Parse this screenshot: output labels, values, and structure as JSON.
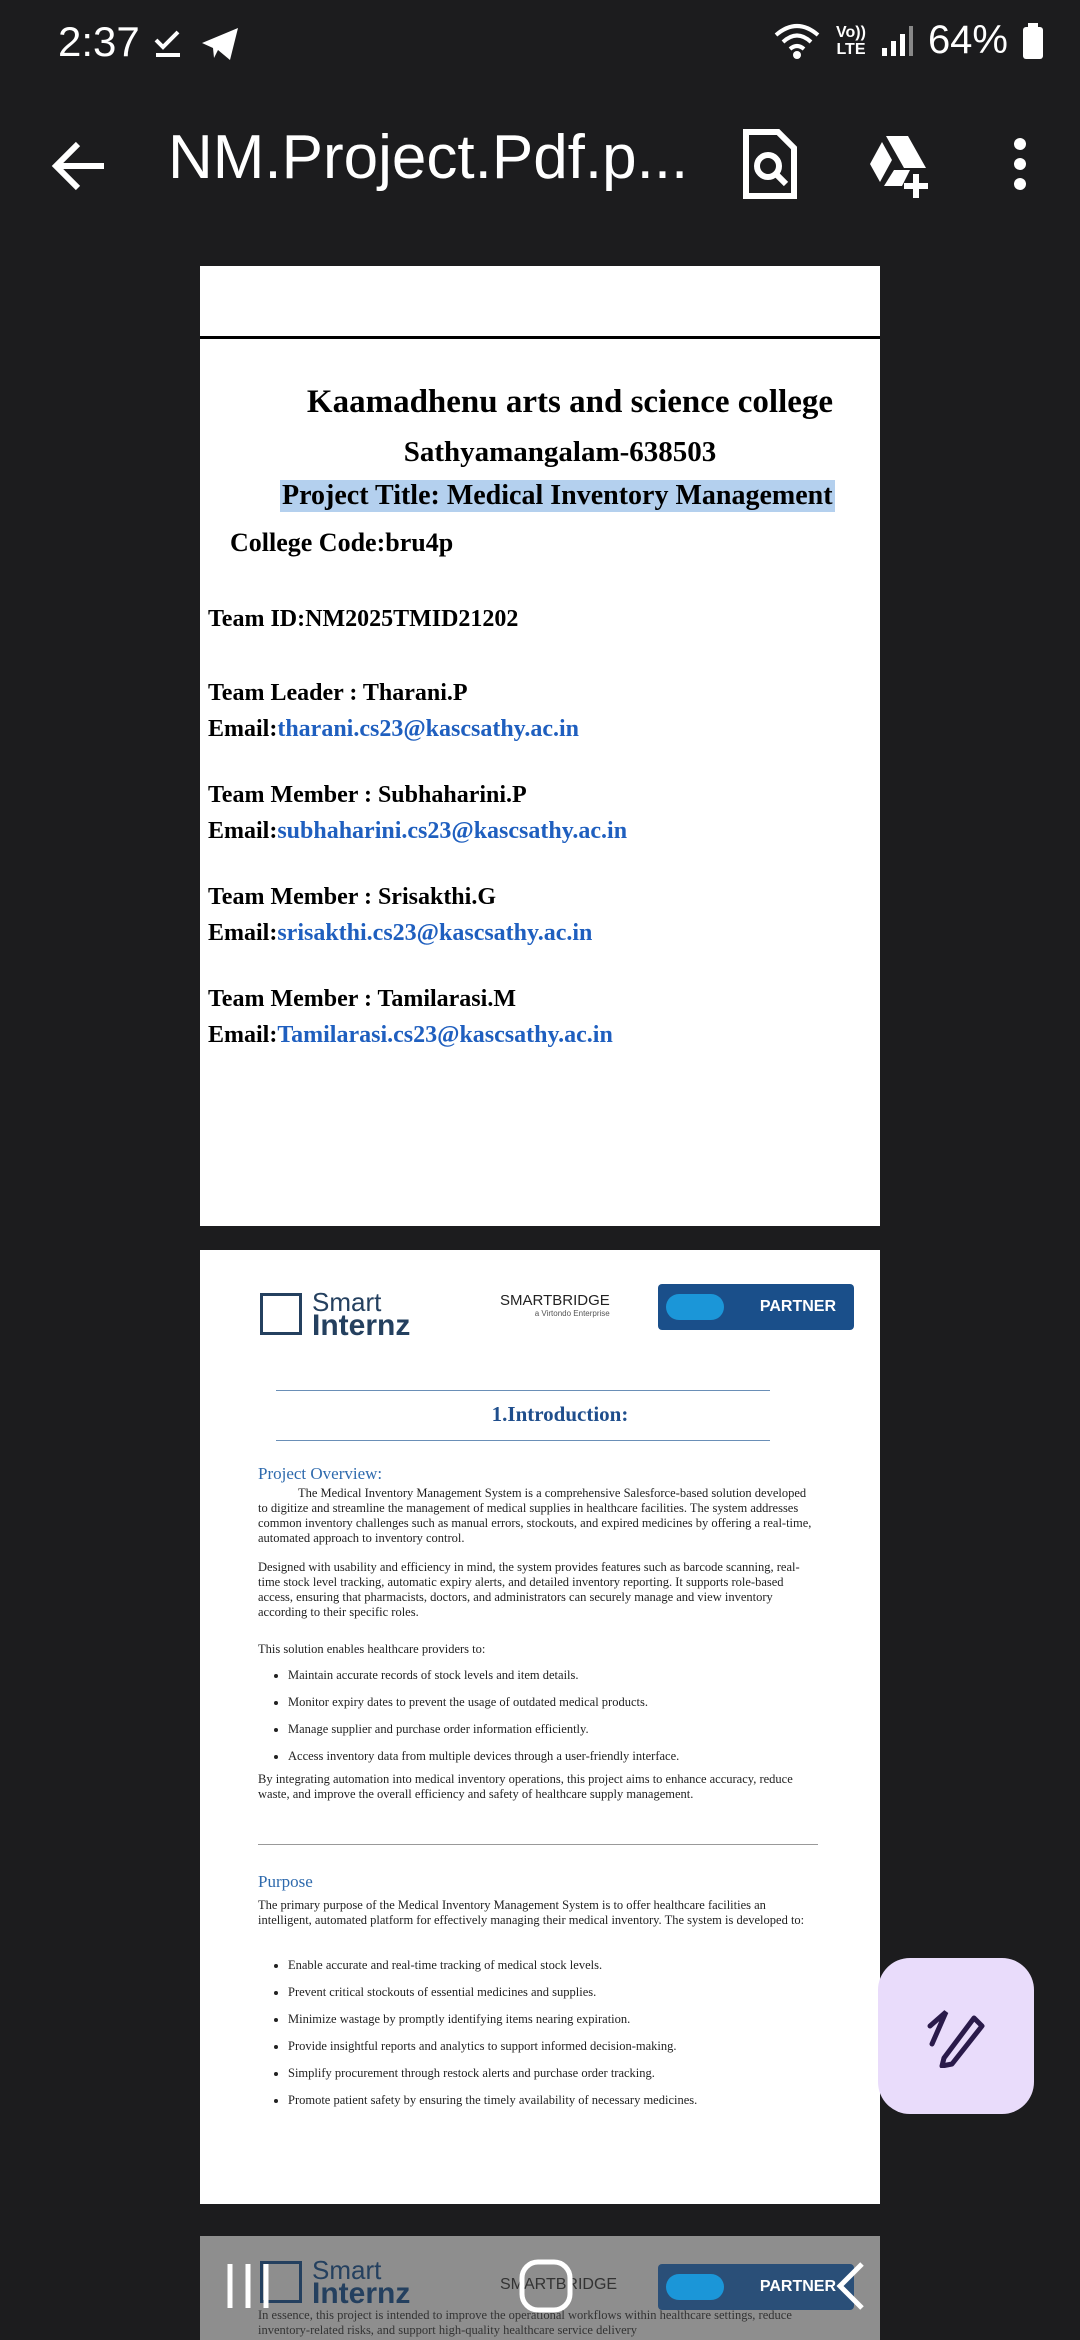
{
  "status": {
    "time": "2:37",
    "lte_top": "Vo))",
    "lte_bottom": "LTE",
    "battery": "64%"
  },
  "appbar": {
    "title": "NM.Project.Pdf.p..."
  },
  "page1": {
    "college": "Kaamadhenu arts and science college",
    "place": "Sathyamangalam-638503",
    "project_title": "Project Title: Medical Inventory Management",
    "college_code": "College Code:bru4p",
    "team_id": "Team ID:NM2025TMID21202",
    "members": [
      {
        "role": "Team Leader : Tharani.P",
        "email_label": "Email:",
        "email": "tharani.cs23@kascsathy.ac.in"
      },
      {
        "role": "Team Member : Subhaharini.P",
        "email_label": "Email:",
        "email": "subhaharini.cs23@kascsathy.ac.in"
      },
      {
        "role": "Team Member : Srisakthi.G",
        "email_label": "Email:",
        "email": "srisakthi.cs23@kascsathy.ac.in"
      },
      {
        "role": "Team Member : Tamilarasi.M",
        "email_label": "Email:",
        "email": "Tamilarasi.cs23@kascsathy.ac.in"
      }
    ]
  },
  "page2": {
    "logo_smart_top": "Smart",
    "logo_smart_bottom": "Internz",
    "logo_smartbridge": "SMARTBRIDGE",
    "logo_smartbridge_sub": "a Virtondo Enterprise",
    "partner": "PARTNER",
    "intro_title": "1.Introduction:",
    "overview_head": "Project Overview:",
    "overview_p1": "The Medical Inventory Management System is a comprehensive Salesforce-based solution developed to digitize and streamline the management of medical supplies in healthcare facilities. The system addresses common inventory challenges such as manual errors, stockouts, and expired medicines by offering a real-time, automated approach to inventory control.",
    "overview_p2": "Designed with usability and efficiency in mind, the system provides features such as barcode scanning, real-time stock level tracking, automatic expiry alerts, and detailed inventory reporting. It supports role-based access, ensuring that pharmacists, doctors, and administrators can securely manage and view inventory according to their specific roles.",
    "overview_p3": "This solution enables healthcare providers to:",
    "bullets1": [
      "Maintain accurate records of stock levels and item details.",
      "Monitor expiry dates to prevent the usage of outdated medical products.",
      "Manage supplier and purchase order information efficiently.",
      "Access inventory data from multiple devices through a user-friendly interface."
    ],
    "overview_p4": "By integrating automation into medical inventory operations, this project aims to enhance accuracy, reduce waste, and improve the overall efficiency and safety of healthcare supply management.",
    "purpose_head": "Purpose",
    "purpose_p1": "The primary purpose of the Medical Inventory Management System is to offer healthcare facilities an intelligent, automated platform for effectively managing their medical inventory. The system is developed to:",
    "bullets2": [
      "Enable accurate and real-time tracking of medical stock levels.",
      "Prevent critical stockouts of essential medicines and supplies.",
      "Minimize wastage by promptly identifying items nearing expiration.",
      "Provide insightful reports and analytics to support informed decision-making.",
      "Simplify procurement through restock alerts and purchase order tracking.",
      "Promote patient safety by ensuring the timely availability of necessary medicines."
    ]
  },
  "page3": {
    "logo_smart_top": "Smart",
    "logo_smart_bottom": "Internz",
    "logo_smartbridge": "SMARTBRIDGE",
    "partner": "PARTNER",
    "peek_text": "In essence, this project is intended to improve the operational workflows within healthcare settings, reduce inventory-related risks, and support high-quality healthcare service delivery"
  }
}
